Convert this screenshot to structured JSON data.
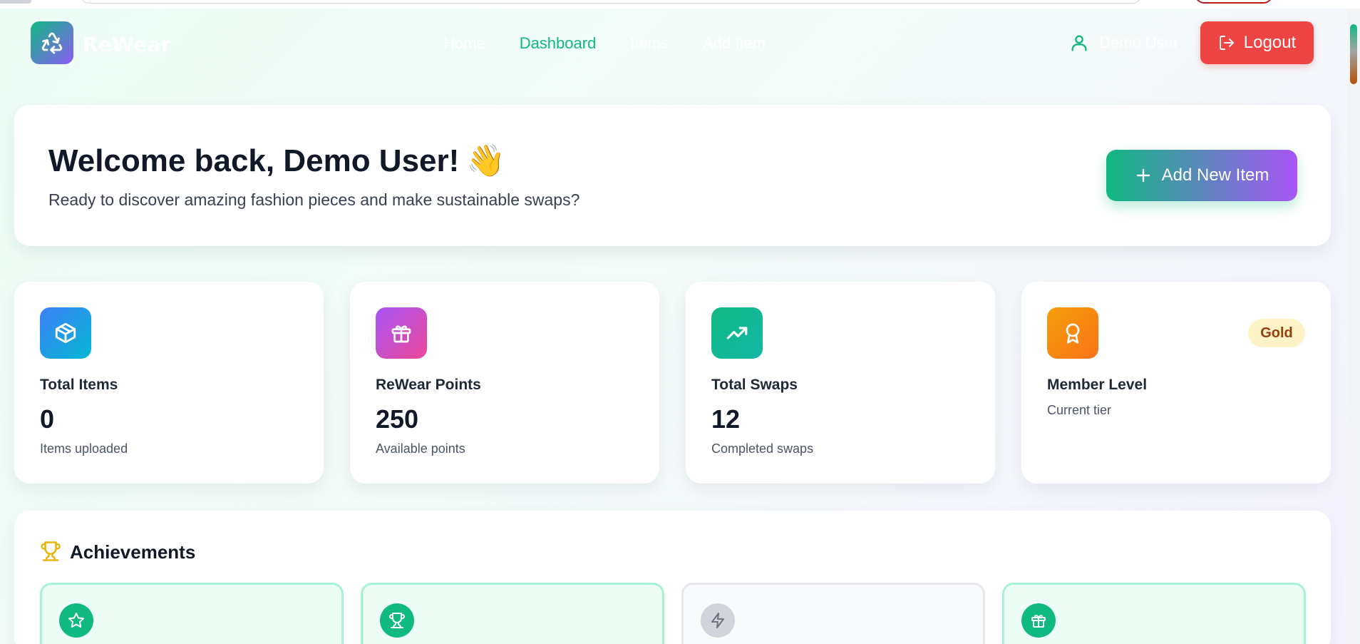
{
  "brand": {
    "name": "ReWear",
    "logo_icon": "recycle-icon"
  },
  "nav": {
    "items": [
      {
        "label": "Home",
        "active": false
      },
      {
        "label": "Dashboard",
        "active": true
      },
      {
        "label": "Items",
        "active": false
      },
      {
        "label": "Add Item",
        "active": false
      }
    ]
  },
  "user": {
    "name": "Demo User",
    "icon": "user-icon"
  },
  "logout": {
    "label": "Logout",
    "icon": "logout-icon"
  },
  "welcome": {
    "title": "Welcome back, Demo User!",
    "emoji": "👋",
    "subtitle": "Ready to discover amazing fashion pieces and make sustainable swaps?",
    "add_button": "Add New Item"
  },
  "stats": [
    {
      "label": "Total Items",
      "value": "0",
      "sub": "Items uploaded",
      "icon": "box-icon",
      "color_from": "#3b82f6",
      "color_to": "#06b6d4"
    },
    {
      "label": "ReWear Points",
      "value": "250",
      "sub": "Available points",
      "icon": "gift-icon",
      "color_from": "#a855f7",
      "color_to": "#ec4899"
    },
    {
      "label": "Total Swaps",
      "value": "12",
      "sub": "Completed swaps",
      "icon": "trending-up-icon",
      "color_from": "#10b981",
      "color_to": "#14b8a6"
    },
    {
      "label": "Member Level",
      "value": "",
      "sub": "Current tier",
      "badge": "Gold",
      "icon": "award-icon",
      "color_from": "#f59e0b",
      "color_to": "#f97316"
    }
  ],
  "achievements": {
    "title": "Achievements",
    "cards": [
      {
        "icon": "star-icon",
        "unlocked": true
      },
      {
        "icon": "trophy-icon",
        "unlocked": true
      },
      {
        "icon": "bolt-icon",
        "unlocked": false
      },
      {
        "icon": "gift-icon",
        "unlocked": true
      }
    ]
  },
  "colors": {
    "accent": "#10b981",
    "danger": "#ef4444",
    "purple": "#a855f7"
  }
}
